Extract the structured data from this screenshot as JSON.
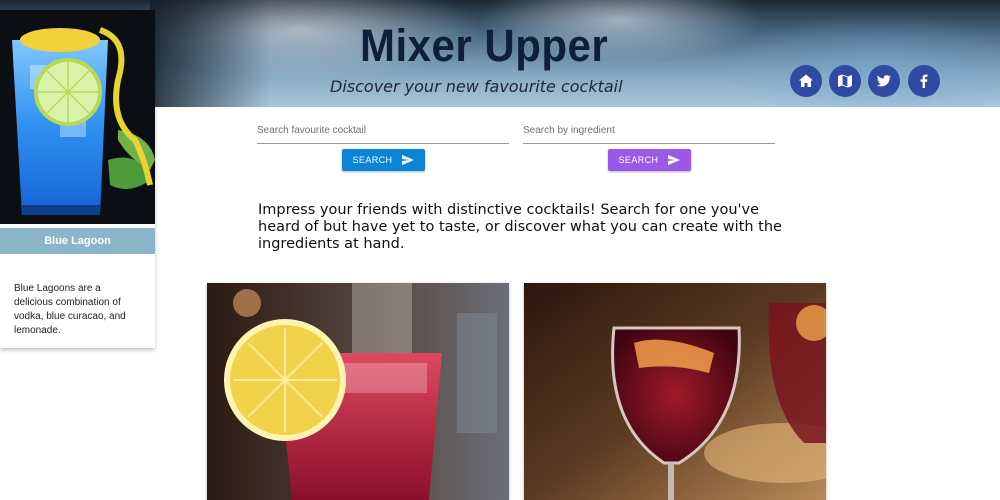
{
  "header": {
    "title": "Mixer Upper",
    "tagline": "Discover your new favourite cocktail",
    "social_icons": [
      "home-icon",
      "map-icon",
      "twitter-icon",
      "facebook-icon"
    ],
    "icon_color": "#2f4aa0"
  },
  "featured": {
    "name": "Blue Lagoon",
    "description": "Blue Lagoons are a delicious combination of vodka, blue curacao, and lemonade.",
    "title_bar_color": "#8bb6c9"
  },
  "search": {
    "cocktail": {
      "placeholder": "Search favourite cocktail",
      "value": "",
      "button_label": "SEARCH",
      "button_color": "#0a84d6"
    },
    "ingredient": {
      "placeholder": "Search by ingredient",
      "value": "",
      "button_label": "SEARCH",
      "button_color": "#9b59e8"
    }
  },
  "intro_text": "Impress your friends with distinctive cocktails! Search for one you've heard of but have yet to taste, or discover what you can create with the ingredients at hand.",
  "cards": [
    {
      "image": "red cocktail with lemon slice"
    },
    {
      "image": "red wine sangria glass"
    }
  ]
}
